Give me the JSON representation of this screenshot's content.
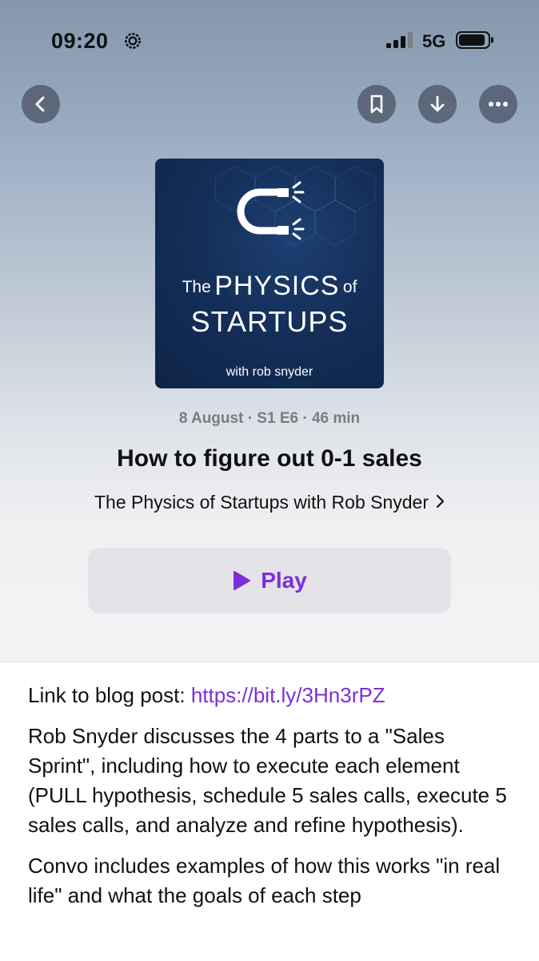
{
  "status_bar": {
    "time": "09:20",
    "network": "5G"
  },
  "nav": {
    "back_icon": "chevron-left-icon",
    "bookmark_icon": "bookmark-icon",
    "download_icon": "download-icon",
    "more_icon": "ellipsis-icon"
  },
  "artwork": {
    "title_prefix": "The",
    "title_main": "PHYSICS",
    "title_suffix": "of",
    "title_line2": "STARTUPS",
    "host_line": "with rob snyder",
    "logo_icon": "magnet-icon"
  },
  "episode": {
    "meta": "8 August · S1 E6 · 46 min",
    "title": "How to figure out 0-1 sales",
    "show_name": "The Physics of Startups with Rob Snyder"
  },
  "play_button": {
    "label": "Play",
    "icon": "play-icon"
  },
  "description": {
    "link_label": "Link to blog post:",
    "link_url": "https://bit.ly/3Hn3rPZ",
    "paragraph1": "Rob Snyder discusses the 4 parts to a \"Sales Sprint\", including how to execute each element (PULL hypothesis, schedule 5 sales calls, execute 5 sales calls, and analyze and refine hypothesis).",
    "paragraph2": "Convo includes examples of how this works \"in real life\" and what the goals of each step"
  },
  "colors": {
    "accent": "#7b2fd8",
    "artwork_bg": "#142f59",
    "button_bg": "#e3e3e8"
  }
}
